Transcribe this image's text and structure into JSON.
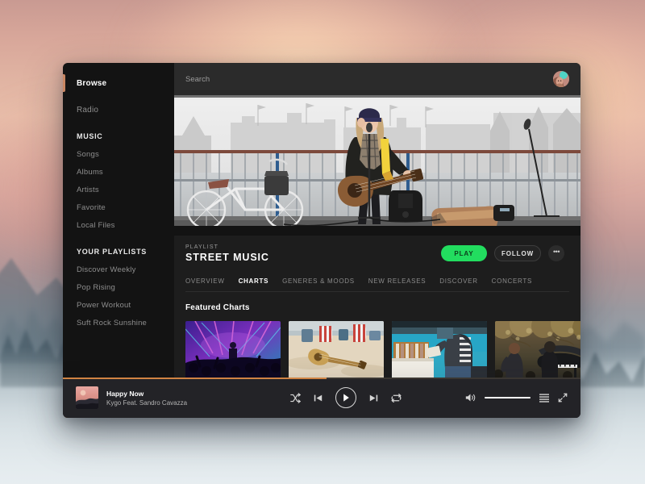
{
  "window": {
    "accent_orange": "#d08343",
    "accent_green": "#22dd5f",
    "sidebar_bg": "#131313",
    "main_bg": "#1d1d1d",
    "player_bg": "#232327"
  },
  "sidebar": {
    "top_items": [
      {
        "label": "Browse",
        "active": true
      },
      {
        "label": "Radio",
        "active": false
      }
    ],
    "sections": [
      {
        "heading": "MUSIC",
        "items": [
          {
            "label": "Songs"
          },
          {
            "label": "Albums"
          },
          {
            "label": "Artists"
          },
          {
            "label": "Favorite"
          },
          {
            "label": "Local Files"
          }
        ]
      },
      {
        "heading": "YOUR PLAYLISTS",
        "items": [
          {
            "label": "Discover Weekly"
          },
          {
            "label": "Pop Rising"
          },
          {
            "label": "Power Workout"
          },
          {
            "label": "Suft Rock Sunshine"
          }
        ]
      }
    ]
  },
  "header": {
    "search_placeholder": "Search",
    "search_value": "",
    "avatar_name": "user-avatar"
  },
  "hero": {
    "alt": "street musician playing acoustic guitar on a bridge"
  },
  "playlist": {
    "kicker": "PLAYLIST",
    "title": "STREET MUSIC",
    "play_label": "PLAY",
    "follow_label": "FOLLOW",
    "more_label": "•••"
  },
  "tabs": [
    {
      "label": "OVERVIEW",
      "active": false
    },
    {
      "label": "CHARTS",
      "active": true
    },
    {
      "label": "GENERES & MOODS",
      "active": false
    },
    {
      "label": "NEW RELEASES",
      "active": false
    },
    {
      "label": "DISCOVER",
      "active": false
    },
    {
      "label": "CONCERTS",
      "active": false
    }
  ],
  "content": {
    "featured_heading": "Featured Charts",
    "cards": [
      {
        "alt": "concert crowd with purple and blue stage lights"
      },
      {
        "alt": "acoustic guitar lying on a beach with striped beach chairs"
      },
      {
        "alt": "people browsing vinyl records at an outdoor market"
      },
      {
        "alt": "grand piano performance outdoors under blossom trees"
      }
    ]
  },
  "player": {
    "track_title": "Happy Now",
    "track_artist": "Kygo Feat. Sandro Cavazza",
    "progress_percent": 51,
    "volume_percent": 100,
    "album_art_alt": "pink sunset over dark hills album cover",
    "controls": {
      "shuffle": "shuffle-icon",
      "previous": "previous-track-icon",
      "play": "play-icon",
      "next": "next-track-icon",
      "repeat": "repeat-icon",
      "volume": "volume-icon",
      "queue": "queue-list-icon",
      "fullscreen": "fullscreen-icon"
    }
  }
}
